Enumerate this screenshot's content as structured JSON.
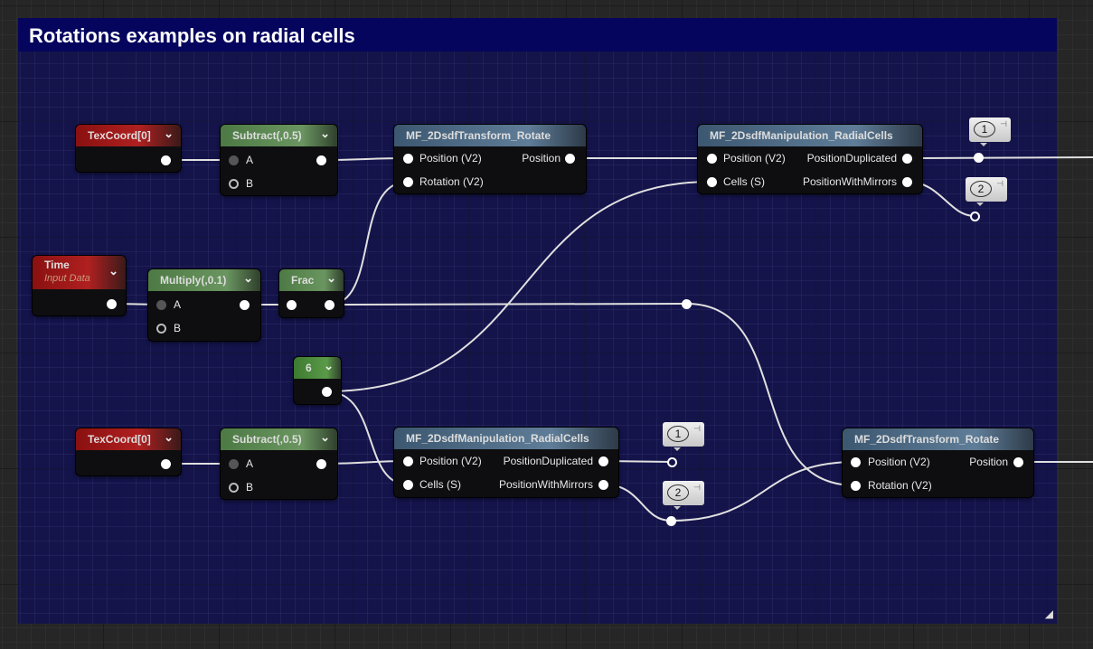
{
  "comment": {
    "title": "Rotations examples on radial cells"
  },
  "nodes": {
    "texcoord_top": {
      "title": "TexCoord[0]"
    },
    "subtract_top": {
      "title": "Subtract(,0.5)",
      "inputs": [
        "A",
        "B"
      ]
    },
    "rotate_top": {
      "title": "MF_2DsdfTransform_Rotate",
      "inputs": [
        "Position (V2)",
        "Rotation (V2)"
      ],
      "outputs": [
        "Position"
      ]
    },
    "radial_top": {
      "title": "MF_2DsdfManipulation_RadialCells",
      "inputs": [
        "Position (V2)",
        "Cells (S)"
      ],
      "outputs": [
        "PositionDuplicated",
        "PositionWithMirrors"
      ]
    },
    "time": {
      "title": "Time",
      "subtitle": "Input Data"
    },
    "multiply": {
      "title": "Multiply(,0.1)",
      "inputs": [
        "A",
        "B"
      ]
    },
    "frac": {
      "title": "Frac"
    },
    "constant": {
      "title": "6"
    },
    "texcoord_bottom": {
      "title": "TexCoord[0]"
    },
    "subtract_bottom": {
      "title": "Subtract(,0.5)",
      "inputs": [
        "A",
        "B"
      ]
    },
    "radial_bottom": {
      "title": "MF_2DsdfManipulation_RadialCells",
      "inputs": [
        "Position (V2)",
        "Cells (S)"
      ],
      "outputs": [
        "PositionDuplicated",
        "PositionWithMirrors"
      ]
    },
    "rotate_bottom": {
      "title": "MF_2DsdfTransform_Rotate",
      "inputs": [
        "Position (V2)",
        "Rotation (V2)"
      ],
      "outputs": [
        "Position"
      ]
    }
  },
  "reroutes": [
    "1",
    "2",
    "1",
    "2"
  ],
  "chevron": "⌄",
  "colors": {
    "comment_bg": "#14134a",
    "comment_title": "#05055e",
    "wire": "#e0e0e0"
  }
}
